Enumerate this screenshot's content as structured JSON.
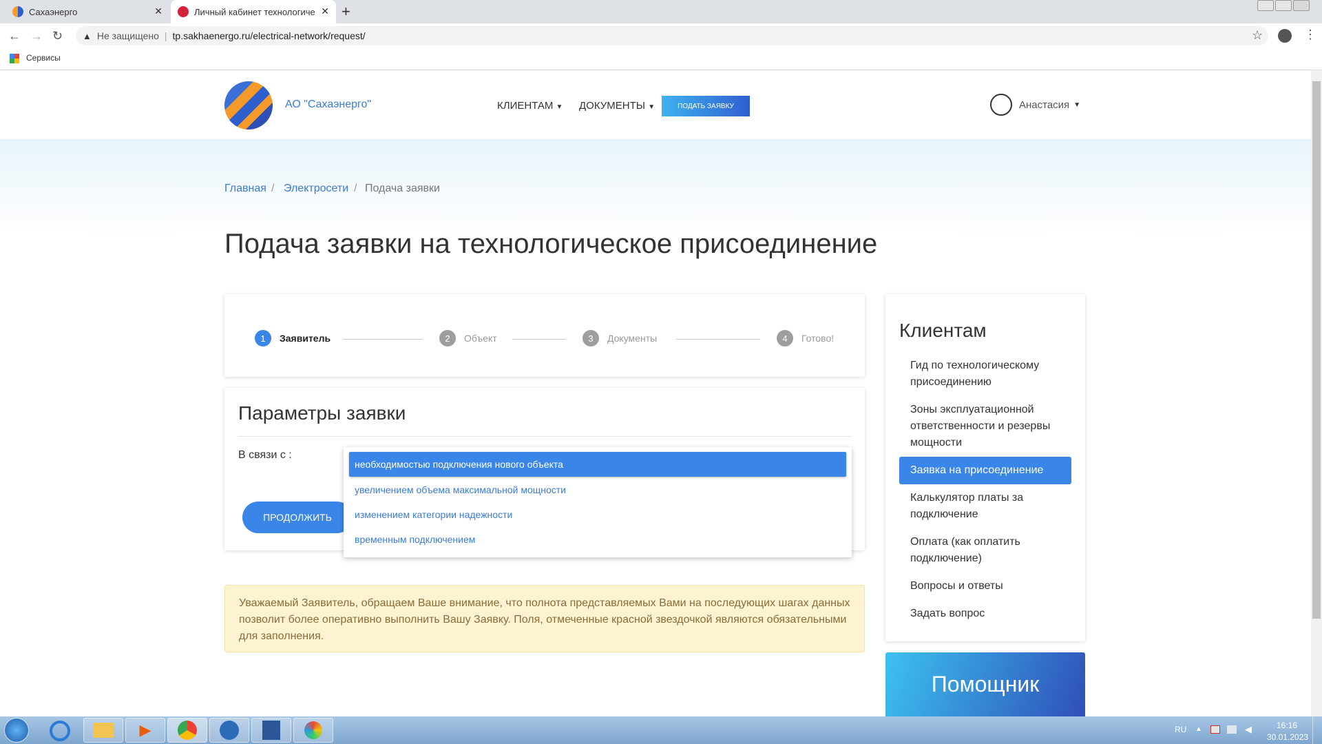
{
  "browser": {
    "tabs": [
      {
        "title": "Сахаэнерго"
      },
      {
        "title": "Личный кабинет технологическ"
      }
    ],
    "new_tab": "+",
    "security_label": "Не защищено",
    "url": "tp.sakhaenergo.ru/electrical-network/request/",
    "bookmarks_label": "Сервисы"
  },
  "header": {
    "company": "АО \"Сахаэнерго\"",
    "nav": [
      "КЛИЕНТАМ",
      "ДОКУМЕНТЫ"
    ],
    "apply_button": "ПОДАТЬ ЗАЯВКУ",
    "user": "Анастасия"
  },
  "breadcrumb": {
    "items": [
      "Главная",
      "Электросети",
      "Подача заявки"
    ],
    "separator": "/"
  },
  "page_title": "Подача заявки на технологическое присоединение",
  "steps": [
    {
      "num": "1",
      "label": "Заявитель",
      "active": true
    },
    {
      "num": "2",
      "label": "Объект",
      "active": false
    },
    {
      "num": "3",
      "label": "Документы",
      "active": false
    },
    {
      "num": "4",
      "label": "Готово!",
      "active": false
    }
  ],
  "form": {
    "title": "Параметры заявки",
    "reason_label": "В связи с :",
    "options": [
      "необходимостью подключения нового объекта",
      "увеличением объема максимальной мощности",
      "изменением категории надежности",
      "временным подключением"
    ],
    "selected_index": 0,
    "continue_button": "ПРОДОЛЖИТЬ"
  },
  "notice": "Уважаемый Заявитель, обращаем Ваше внимание, что полнота представляемых Вами на последующих шагах данных позволит более оперативно выполнить Вашу Заявку. Поля, отмеченные красной звездочкой являются обязательными для заполнения.",
  "sidebar": {
    "title": "Клиентам",
    "items": [
      "Гид по технологическому присоединению",
      "Зоны эксплуатационной ответственности и резервы мощности",
      "Заявка на присоединение",
      "Калькулятор платы за подключение",
      "Оплата (как оплатить подключение)",
      "Вопросы и ответы",
      "Задать вопрос"
    ],
    "active_index": 2
  },
  "helper_title": "Помощник",
  "taskbar": {
    "lang": "RU",
    "time": "16:16",
    "date": "30.01.2023"
  },
  "colors": {
    "primary": "#3a7bd5",
    "step_active": "#3a86e8",
    "step_inactive": "#9e9e9e",
    "notice_bg": "#fdf3d1",
    "notice_text": "#8a6d3b"
  }
}
